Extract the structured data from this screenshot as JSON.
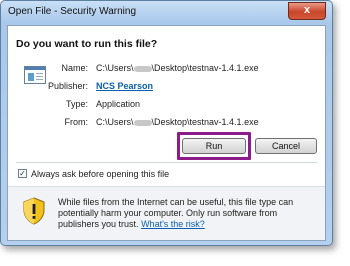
{
  "window": {
    "title": "Open File - Security Warning",
    "close_symbol": "x"
  },
  "dialog": {
    "heading": "Do you want to run this file?",
    "fields": {
      "name": {
        "label": "Name:",
        "value_prefix": "C:\\Users\\",
        "value_suffix": "\\Desktop\\testnav-1.4.1.exe"
      },
      "publisher": {
        "label": "Publisher:",
        "value": "NCS Pearson"
      },
      "type": {
        "label": "Type:",
        "value": "Application"
      },
      "from": {
        "label": "From:",
        "value_prefix": "C:\\Users\\",
        "value_suffix": "\\Desktop\\testnav-1.4.1.exe"
      }
    },
    "buttons": {
      "run": "Run",
      "cancel": "Cancel"
    },
    "checkbox": {
      "label": "Always ask before opening this file",
      "checked": true,
      "mark": "✓"
    },
    "warning": {
      "text": "While files from the Internet can be useful, this file type can potentially harm your computer. Only run software from publishers you trust.",
      "link": "What's the risk?"
    }
  },
  "colors": {
    "highlight_border": "#8e1b8a",
    "link": "#0b5fb0",
    "shield_yellow": "#f2c21a"
  }
}
